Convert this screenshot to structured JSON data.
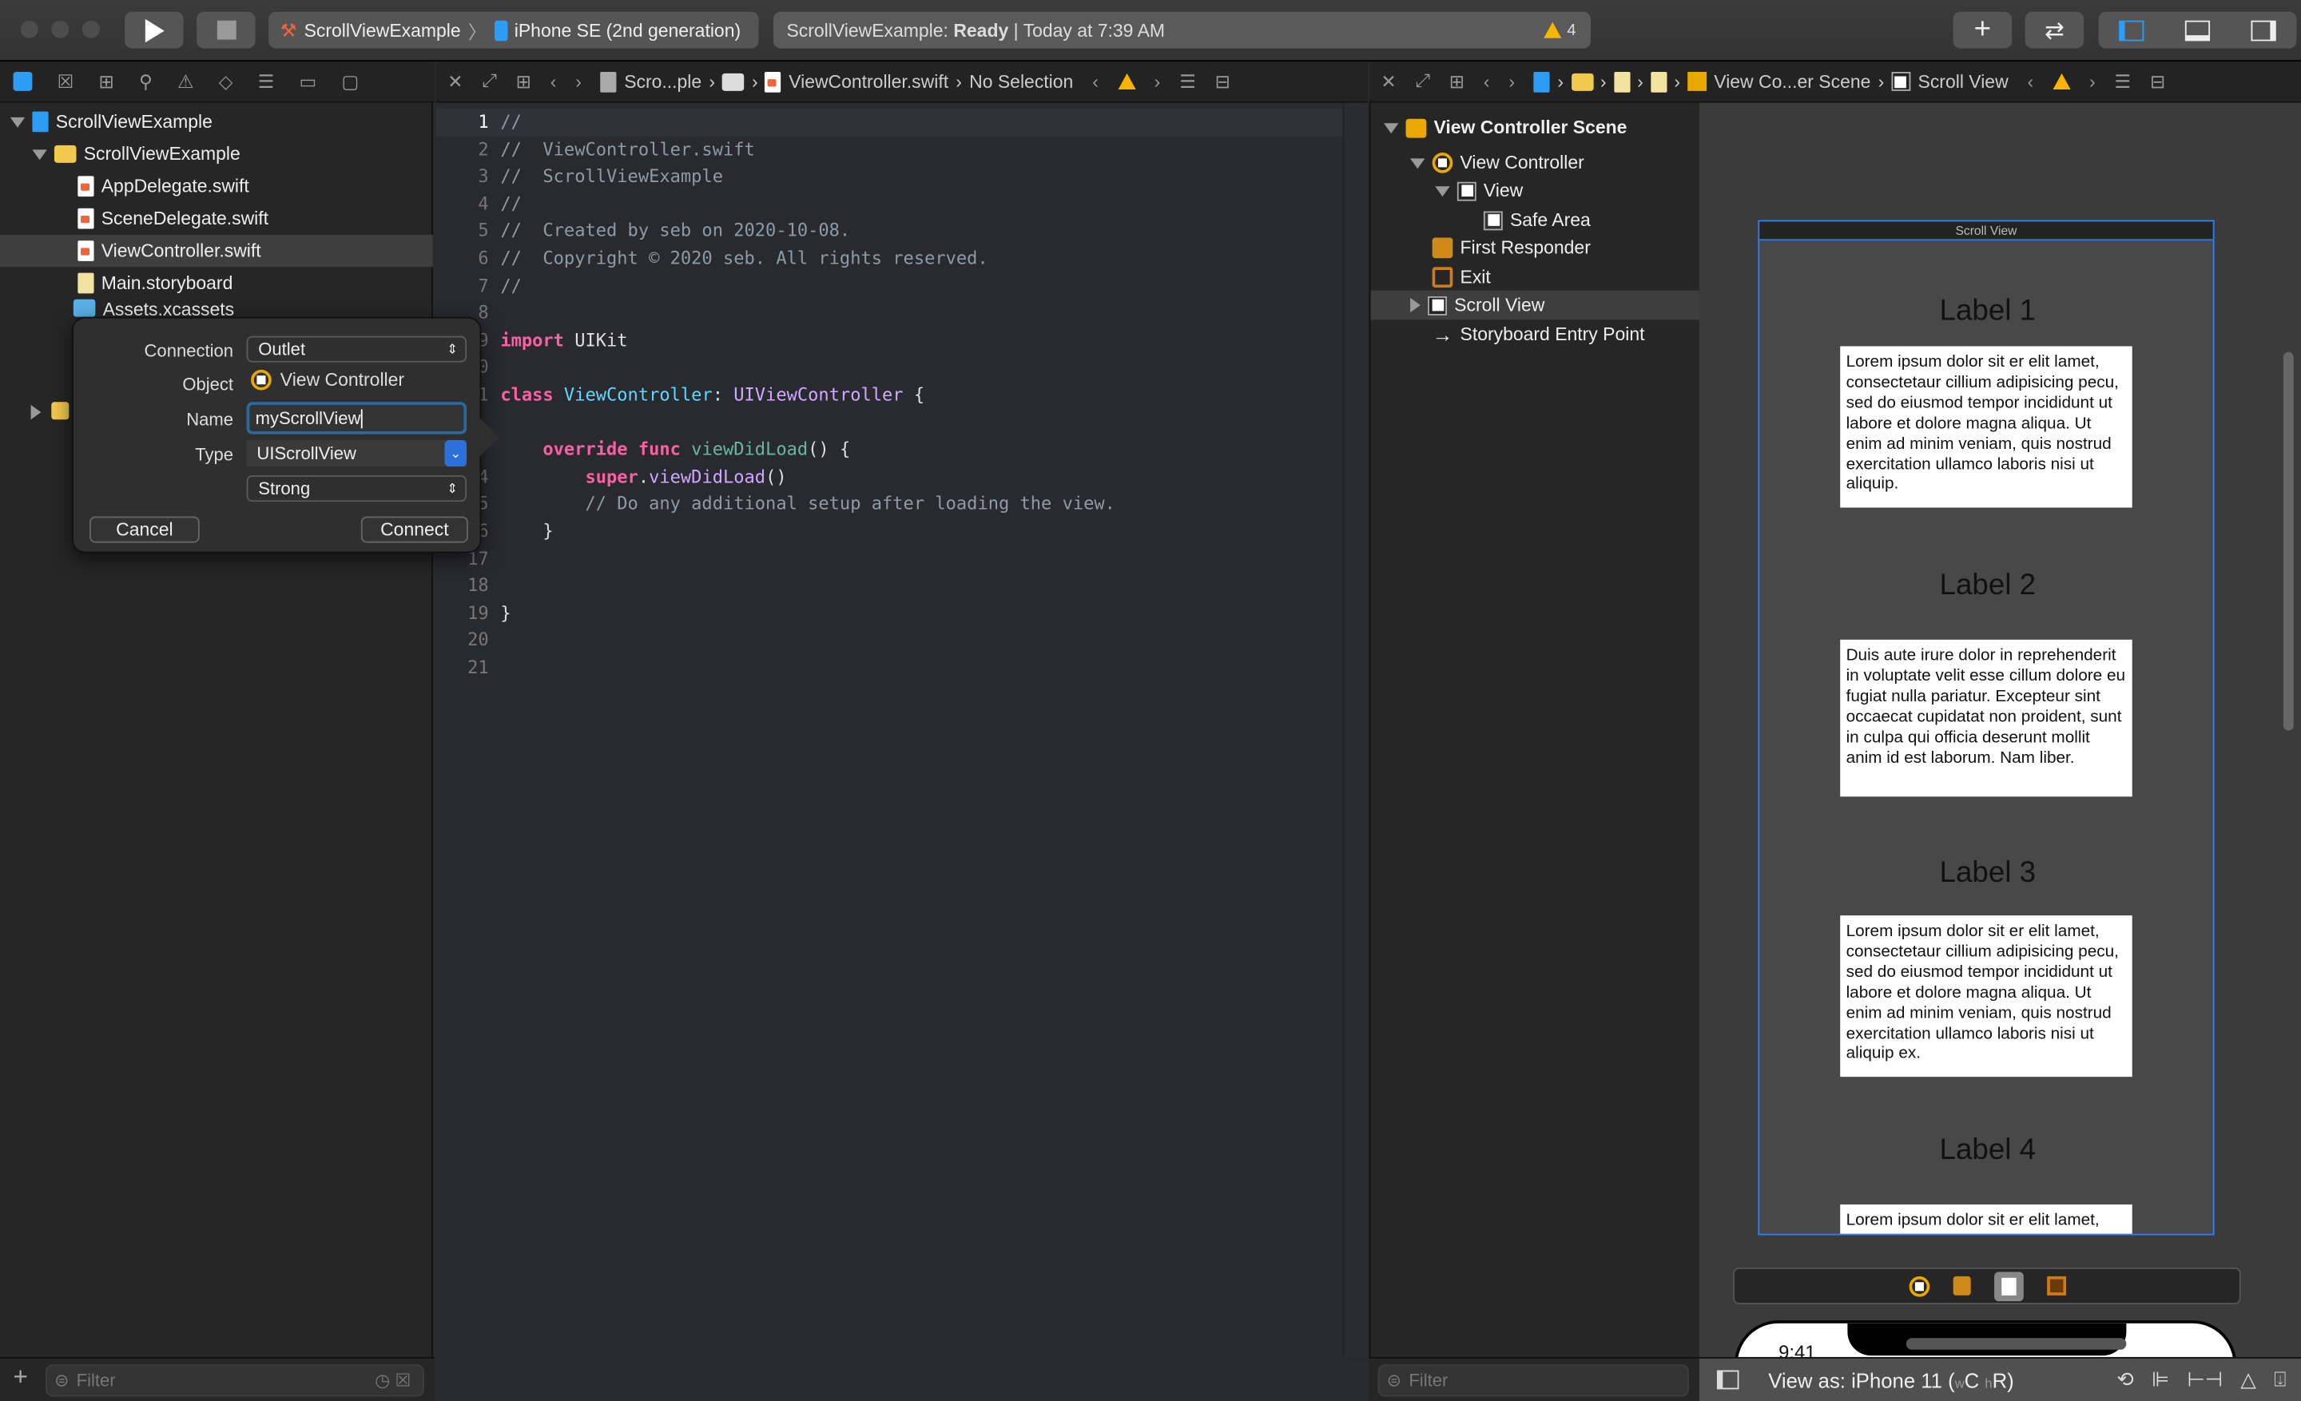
{
  "toolbar": {
    "scheme": "ScrollViewExample",
    "device": "iPhone SE (2nd generation)",
    "status_project": "ScrollViewExample:",
    "status_state": "Ready",
    "status_time": "| Today at 7:39 AM",
    "warning_count": "4",
    "warning_color": "#f7b500",
    "accent": "#2d9cf5"
  },
  "editor_jumpbar": {
    "project": "Scro...ple",
    "file": "ViewController.swift",
    "selection": "No Selection"
  },
  "ib_jumpbar": {
    "scene": "View Co...er Scene",
    "object": "Scroll View"
  },
  "navigator": {
    "items": [
      {
        "label": "ScrollViewExample"
      },
      {
        "label": "ScrollViewExample"
      },
      {
        "label": "AppDelegate.swift"
      },
      {
        "label": "SceneDelegate.swift"
      },
      {
        "label": "ViewController.swift"
      },
      {
        "label": "Main.storyboard"
      },
      {
        "label": "Assets.xcassets"
      }
    ],
    "filter_placeholder": "Filter"
  },
  "popup": {
    "connection_label": "Connection",
    "connection_value": "Outlet",
    "object_label": "Object",
    "object_value": "View Controller",
    "name_label": "Name",
    "name_value": "myScrollView",
    "type_label": "Type",
    "type_value": "UIScrollView",
    "storage_value": "Strong",
    "cancel": "Cancel",
    "connect": "Connect"
  },
  "code": {
    "line_numbers": [
      "1",
      "2",
      "3",
      "4",
      "5",
      "6",
      "7",
      "8",
      "9",
      "0",
      "1",
      "",
      "",
      "4",
      "5",
      "6",
      "17",
      "18",
      "19",
      "20",
      "21"
    ],
    "l1": "//",
    "l2": "//  ViewController.swift",
    "l3": "//  ScrollViewExample",
    "l4": "//",
    "l5": "//  Created by seb on 2020-10-08.",
    "l6": "//  Copyright © 2020 seb. All rights reserved.",
    "l7": "//",
    "import_kw": "import",
    "import_mod": " UIKit",
    "class_kw": "class",
    "class_name": " ViewController",
    "colon": ": ",
    "superclass": "UIViewController",
    "brace_open": " {",
    "override_kw": "    override func",
    "func_name": " viewDidLoad",
    "func_tail": "() {",
    "super_kw": "        super",
    "dot": ".",
    "super_call": "viewDidLoad",
    "parens": "()",
    "comment_setup": "        // Do any additional setup after loading the view.",
    "close_inner": "    }",
    "close_outer": "}"
  },
  "outline": {
    "items": [
      {
        "label": "View Controller Scene"
      },
      {
        "label": "View Controller"
      },
      {
        "label": "View"
      },
      {
        "label": "Safe Area"
      },
      {
        "label": "First Responder"
      },
      {
        "label": "Exit"
      },
      {
        "label": "Scroll View"
      },
      {
        "label": "Storyboard Entry Point"
      }
    ],
    "filter_placeholder": "Filter"
  },
  "canvas": {
    "scroll_view_title": "Scroll View",
    "labels": [
      "Label 1",
      "Label 2",
      "Label 3",
      "Label 4"
    ],
    "texts": [
      "Lorem ipsum dolor sit er elit lamet, consectetaur cillium adipisicing pecu, sed do eiusmod tempor incididunt ut labore et dolore magna aliqua. Ut enim ad minim veniam, quis nostrud exercitation ullamco laboris nisi ut aliquip.",
      "Duis aute irure dolor in reprehenderit in voluptate velit esse cillum dolore eu fugiat nulla pariatur. Excepteur sint occaecat cupidatat non proident, sunt in culpa qui officia deserunt mollit anim id est laborum. Nam liber.",
      "Lorem ipsum dolor sit er elit lamet, consectetaur cillium adipisicing pecu, sed do eiusmod tempor incididunt ut labore et dolore magna aliqua. Ut enim ad minim veniam, quis nostrud exercitation ullamco laboris nisi ut aliquip ex.",
      "Lorem ipsum dolor sit er elit lamet,"
    ],
    "phone_time": "9:41",
    "view_as": "View as: iPhone 11 (",
    "size_w": "w",
    "size_c": "C",
    "size_h": "h",
    "size_r": "R)"
  }
}
